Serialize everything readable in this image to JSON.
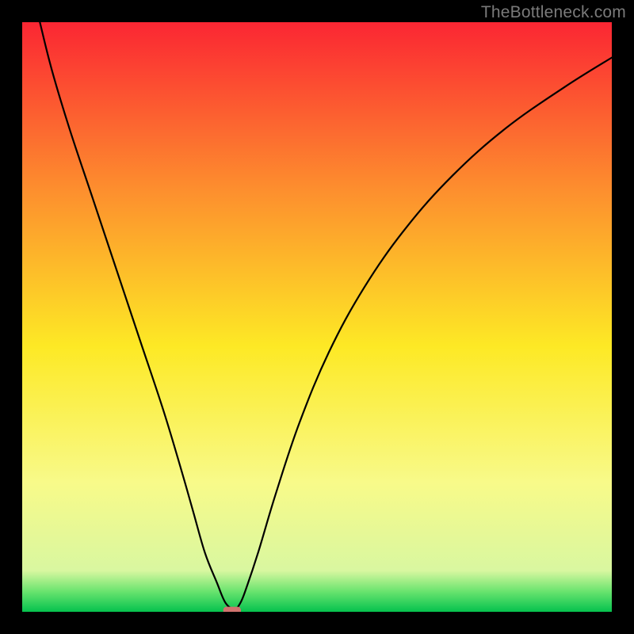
{
  "watermark": "TheBottleneck.com",
  "chart_data": {
    "type": "line",
    "title": "",
    "xlabel": "",
    "ylabel": "",
    "xlim": [
      0,
      100
    ],
    "ylim": [
      0,
      100
    ],
    "grid": false,
    "legend": false,
    "background_gradient": {
      "top": "#fb2633",
      "upper_mid": "#fd8d2e",
      "mid": "#fde925",
      "lower_mid": "#f8fa89",
      "near_bottom": "#6be46f",
      "bottom": "#05c24e"
    },
    "series": [
      {
        "name": "bottleneck-curve",
        "type": "line",
        "color": "#000000",
        "x": [
          3,
          5,
          8,
          12,
          16,
          20,
          24,
          27,
          29,
          31,
          33,
          34.5,
          36,
          37,
          38,
          40,
          43,
          47,
          52,
          58,
          65,
          73,
          82,
          92,
          100
        ],
        "y": [
          100,
          92,
          82,
          70,
          58,
          46,
          34,
          24,
          17,
          10,
          5,
          1.5,
          0.5,
          1.5,
          4,
          10,
          20,
          32,
          44,
          55,
          65,
          74,
          82,
          89,
          94
        ]
      }
    ],
    "marker": {
      "name": "optimal-point",
      "shape": "rounded-rect",
      "color": "#d1736e",
      "x": 35.6,
      "y": 0.2,
      "w": 3.0,
      "h": 1.3
    }
  }
}
